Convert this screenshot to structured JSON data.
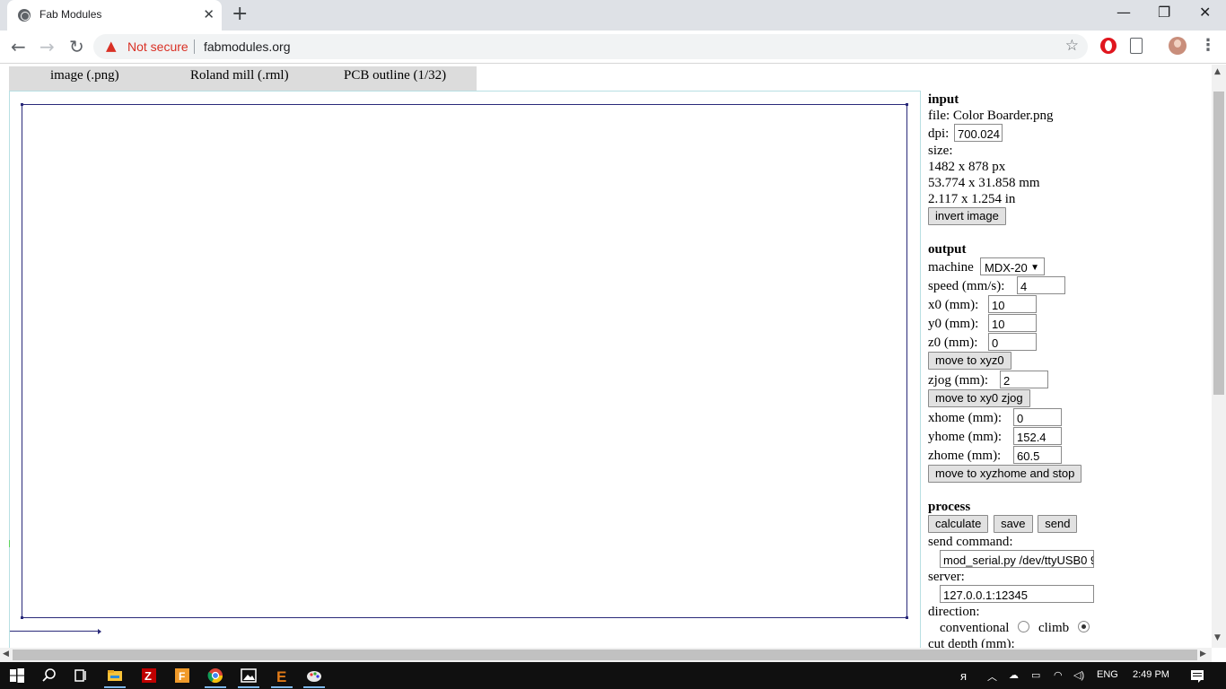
{
  "browser": {
    "tab_title": "Fab Modules",
    "tab_close": "✕",
    "new_tab": "+",
    "window_controls": {
      "minimize": "—",
      "restore": "❐",
      "close": "✕"
    },
    "security_label": "Not secure",
    "url": "fabmodules.org",
    "icons": [
      "back-icon",
      "forward-icon",
      "reload-icon",
      "warning-icon",
      "star-icon",
      "opera-extension-icon",
      "document-extension-icon",
      "profile-avatar",
      "menu-icon"
    ]
  },
  "menubar": {
    "input_format": "image (.png)",
    "output_format": "Roland mill (.rml)",
    "process": "PCB outline (1/32)"
  },
  "input": {
    "heading": "input",
    "file_label": "file: Color Boarder.png",
    "dpi_label": "dpi:",
    "dpi_value": "700.024",
    "size_label": "size:",
    "size_px": "1482 x 878 px",
    "size_mm": "53.774 x 31.858 mm",
    "size_in": "2.117 x 1.254 in",
    "invert_button": "invert image"
  },
  "output": {
    "heading": "output",
    "machine_label": "machine",
    "machine_value": "MDX-20",
    "speed_label": "speed (mm/s):",
    "speed_value": "4",
    "x0_label": "x0 (mm):",
    "x0_value": "10",
    "y0_label": "y0 (mm):",
    "y0_value": "10",
    "z0_label": "z0 (mm):",
    "z0_value": "0",
    "move_xyz0_button": "move to xyz0",
    "zjog_label": "zjog (mm):",
    "zjog_value": "2",
    "move_xy0_zjog_button": "move to xy0 zjog",
    "xhome_label": "xhome (mm):",
    "xhome_value": "0",
    "yhome_label": "yhome (mm):",
    "yhome_value": "152.4",
    "zhome_label": "zhome (mm):",
    "zhome_value": "60.5",
    "move_home_button": "move to xyzhome and stop"
  },
  "process": {
    "heading": "process",
    "calculate_button": "calculate",
    "save_button": "save",
    "send_button": "send",
    "send_command_label": "send command:",
    "send_command_value": "mod_serial.py /dev/ttyUSB0 9",
    "server_label": "server:",
    "server_value": "127.0.0.1:12345",
    "direction_label": "direction:",
    "conventional_label": "conventional",
    "climb_label": "climb",
    "direction_selected": "climb",
    "cut_depth_label": "cut depth (mm):"
  },
  "taskbar": {
    "language": "ENG",
    "time": "2:49 PM",
    "apps": [
      "start-icon",
      "search-icon",
      "task-view-icon",
      "file-explorer-icon",
      "filezilla-icon",
      "fusion-icon",
      "chrome-icon",
      "photos-icon",
      "eagle-icon",
      "paint-icon"
    ]
  }
}
